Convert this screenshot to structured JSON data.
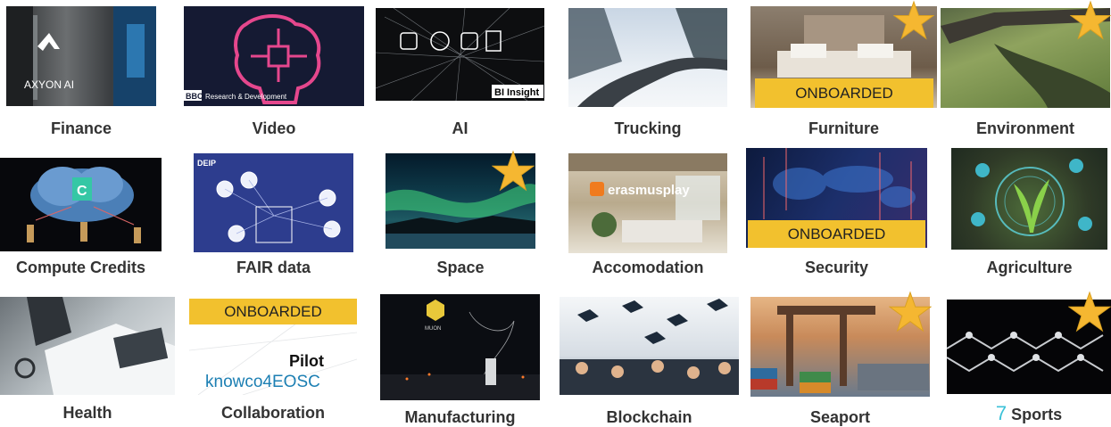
{
  "tiles": [
    {
      "label": "Finance",
      "overlay_text": "AXYON AI",
      "icon": "server-rack-image"
    },
    {
      "label": "Video",
      "overlay_text": "Research & Development",
      "overlay_badge": "BBC",
      "icon": "brain-circuit-image"
    },
    {
      "label": "AI",
      "overlay_badge": "BI Insight",
      "icon": "network-nodes-image"
    },
    {
      "label": "Trucking",
      "icon": "snowy-road-image"
    },
    {
      "label": "Furniture",
      "banner": "ONBOARDED",
      "starred": true,
      "icon": "bedroom-image"
    },
    {
      "label": "Environment",
      "starred": true,
      "icon": "green-water-image"
    },
    {
      "label": "Compute Credits",
      "icon": "cloud-people-image"
    },
    {
      "label": "FAIR data",
      "overlay_text": "DEIP",
      "icon": "data-flow-diagram-image"
    },
    {
      "label": "Space",
      "starred": true,
      "icon": "aurora-image"
    },
    {
      "label": "Accomodation",
      "overlay_text": "erasmusplay",
      "icon": "living-room-image"
    },
    {
      "label": "Security",
      "banner": "ONBOARDED",
      "icon": "digital-world-map-image"
    },
    {
      "label": "Agriculture",
      "icon": "plant-tech-image"
    },
    {
      "label": "Health",
      "icon": "doctor-laptop-image"
    },
    {
      "label": "Collaboration",
      "banner": "ONBOARDED",
      "overlay_text": "Pilot",
      "overlay_logo": "knowco4EOSC",
      "icon": "knowledge-logo-image"
    },
    {
      "label": "Manufacturing",
      "overlay_text": "MUON",
      "icon": "factory-night-image"
    },
    {
      "label": "Blockchain",
      "icon": "graduation-caps-image"
    },
    {
      "label": "Seaport",
      "starred": true,
      "icon": "container-port-image"
    },
    {
      "label": "Sports",
      "starred": true,
      "icon": "molecule-chain-image"
    }
  ],
  "slide_number": "7",
  "colors": {
    "banner": "#f2c12e",
    "star": "#f5b731",
    "label": "#333333",
    "slide_number": "#3cc2d8"
  }
}
